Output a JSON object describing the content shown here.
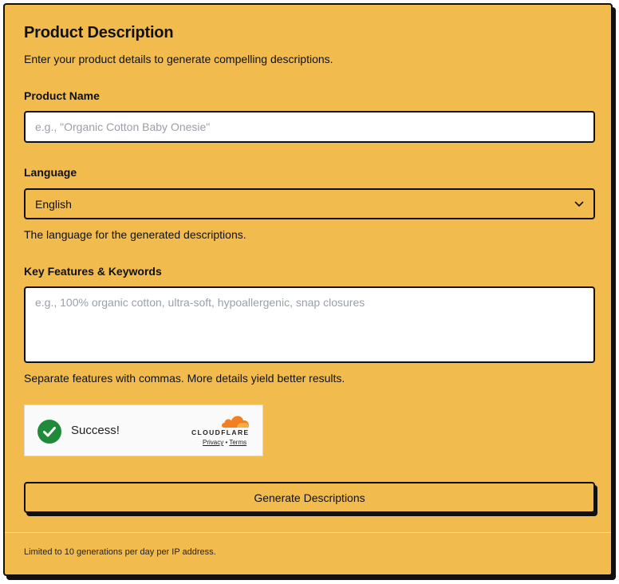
{
  "form": {
    "title": "Product Description",
    "subtitle": "Enter your product details to generate compelling descriptions.",
    "product_name": {
      "label": "Product Name",
      "value": "",
      "placeholder": "e.g., \"Organic Cotton Baby Onesie\""
    },
    "language": {
      "label": "Language",
      "selected": "English",
      "help": "The language for the generated descriptions."
    },
    "features": {
      "label": "Key Features & Keywords",
      "value": "",
      "placeholder": "e.g., 100% organic cotton, ultra-soft, hypoallergenic, snap closures",
      "help": "Separate features with commas. More details yield better results."
    },
    "captcha": {
      "status": "Success!",
      "brand": "CLOUDFLARE",
      "privacy": "Privacy",
      "separator": "•",
      "terms": "Terms"
    },
    "submit_label": "Generate Descriptions",
    "footer_note": "Limited to 10 generations per day per IP address."
  },
  "colors": {
    "card_background": "#f1bb4e",
    "border": "#111111",
    "success_green": "#1e8a3a",
    "cloudflare_orange": "#f38020"
  }
}
